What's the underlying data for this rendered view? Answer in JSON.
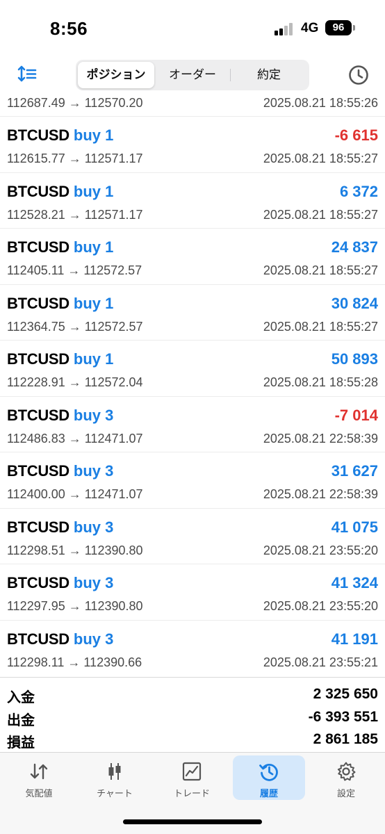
{
  "status_bar": {
    "time": "8:56",
    "network": "4G",
    "battery": "96"
  },
  "toolbar": {
    "tabs": [
      {
        "label": "ポジション",
        "active": true
      },
      {
        "label": "オーダー",
        "active": false
      },
      {
        "label": "約定",
        "active": false
      }
    ]
  },
  "partial_row": {
    "prices": "112687.49 → 112570.20",
    "datetime": "2025.08.21 18:55:26"
  },
  "deals": [
    {
      "symbol": "BTCUSD",
      "side": "buy 1",
      "profit": "-6 615",
      "negative": true,
      "prices": "112615.77 → 112571.17",
      "datetime": "2025.08.21 18:55:27"
    },
    {
      "symbol": "BTCUSD",
      "side": "buy 1",
      "profit": "6 372",
      "negative": false,
      "prices": "112528.21 → 112571.17",
      "datetime": "2025.08.21 18:55:27"
    },
    {
      "symbol": "BTCUSD",
      "side": "buy 1",
      "profit": "24 837",
      "negative": false,
      "prices": "112405.11 → 112572.57",
      "datetime": "2025.08.21 18:55:27"
    },
    {
      "symbol": "BTCUSD",
      "side": "buy 1",
      "profit": "30 824",
      "negative": false,
      "prices": "112364.75 → 112572.57",
      "datetime": "2025.08.21 18:55:27"
    },
    {
      "symbol": "BTCUSD",
      "side": "buy 1",
      "profit": "50 893",
      "negative": false,
      "prices": "112228.91 → 112572.04",
      "datetime": "2025.08.21 18:55:28"
    },
    {
      "symbol": "BTCUSD",
      "side": "buy 3",
      "profit": "-7 014",
      "negative": true,
      "prices": "112486.83 → 112471.07",
      "datetime": "2025.08.21 22:58:39"
    },
    {
      "symbol": "BTCUSD",
      "side": "buy 3",
      "profit": "31 627",
      "negative": false,
      "prices": "112400.00 → 112471.07",
      "datetime": "2025.08.21 22:58:39"
    },
    {
      "symbol": "BTCUSD",
      "side": "buy 3",
      "profit": "41 075",
      "negative": false,
      "prices": "112298.51 → 112390.80",
      "datetime": "2025.08.21 23:55:20"
    },
    {
      "symbol": "BTCUSD",
      "side": "buy 3",
      "profit": "41 324",
      "negative": false,
      "prices": "112297.95 → 112390.80",
      "datetime": "2025.08.21 23:55:20"
    },
    {
      "symbol": "BTCUSD",
      "side": "buy 3",
      "profit": "41 191",
      "negative": false,
      "prices": "112298.11 → 112390.66",
      "datetime": "2025.08.21 23:55:21"
    }
  ],
  "summary": [
    {
      "label": "入金",
      "value": "2 325 650"
    },
    {
      "label": "出金",
      "value": "-6 393 551"
    },
    {
      "label": "損益",
      "value": "2 861 185"
    }
  ],
  "nav": [
    {
      "label": "気配値",
      "icon": "quotes-icon",
      "active": false
    },
    {
      "label": "チャート",
      "icon": "candles-icon",
      "active": false
    },
    {
      "label": "トレード",
      "icon": "trade-chart-icon",
      "active": false
    },
    {
      "label": "履歴",
      "icon": "history-icon",
      "active": true
    },
    {
      "label": "設定",
      "icon": "gear-icon",
      "active": false
    }
  ],
  "colors": {
    "accent": "#1a7fe3",
    "negative": "#e0322f",
    "active_tab_bg": "#d5e8fb"
  }
}
